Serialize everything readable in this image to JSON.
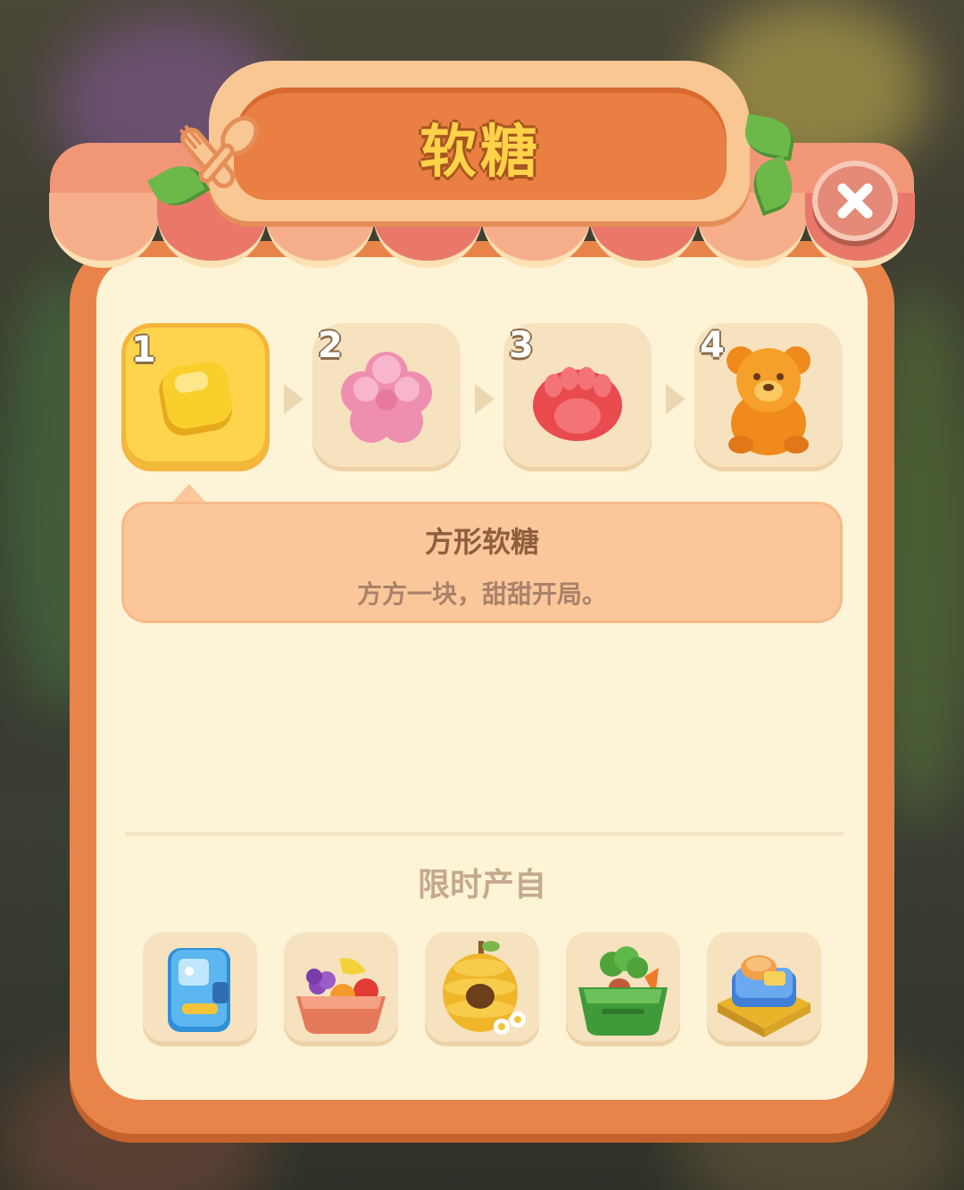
{
  "panel": {
    "title": "软糖"
  },
  "chain": {
    "items": [
      {
        "number": "1",
        "name": "方形软糖",
        "icon": "square-gummy-icon",
        "selected": true
      },
      {
        "number": "2",
        "name": "",
        "icon": "flower-gummy-icon",
        "selected": false
      },
      {
        "number": "3",
        "name": "",
        "icon": "paw-gummy-icon",
        "selected": false
      },
      {
        "number": "4",
        "name": "",
        "icon": "gummy-bear-icon",
        "selected": false
      }
    ]
  },
  "detail": {
    "name": "方形软糖",
    "description": "方方一块，甜甜开局。"
  },
  "sources": {
    "label": "限时产自",
    "items": [
      {
        "icon": "blue-vending-machine-icon"
      },
      {
        "icon": "fruit-basket-icon"
      },
      {
        "icon": "beehive-icon"
      },
      {
        "icon": "vegetable-crate-icon"
      },
      {
        "icon": "bread-tray-icon"
      }
    ]
  },
  "colors": {
    "frame": "#e8844a",
    "panel_bg": "#fdf3d6",
    "title_text": "#ffd24a",
    "selected_slot": "#fed44c"
  }
}
